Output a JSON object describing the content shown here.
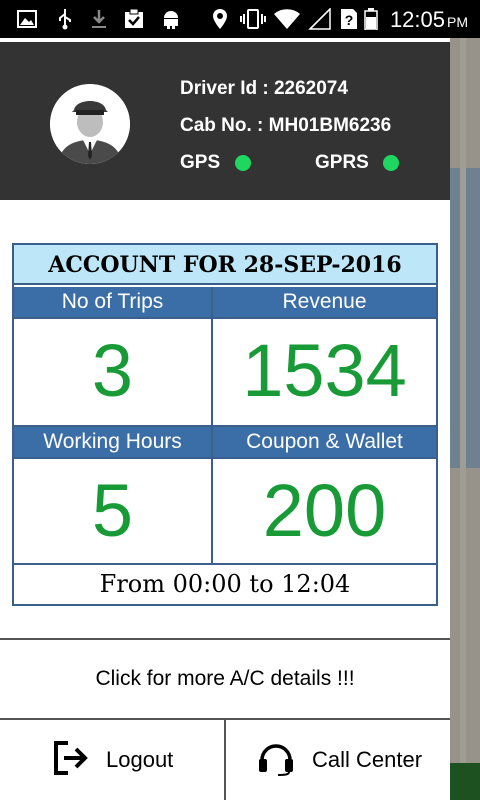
{
  "status_bar": {
    "icons": [
      "gallery-icon",
      "usb-icon",
      "download-icon",
      "clipboard-check-icon",
      "android-icon",
      "location-icon",
      "vibrate-icon",
      "wifi-icon",
      "signal-icon",
      "sim-unknown-icon",
      "battery-icon"
    ],
    "time": "12:05",
    "ampm": "PM"
  },
  "profile": {
    "driver_id": "Driver Id : 2262074",
    "cab_no": "Cab No.  : MH01BM6236",
    "gps_label": "GPS",
    "gprs_label": "GPRS",
    "gps_status_color": "#1ed760",
    "gprs_status_color": "#1ed760"
  },
  "account": {
    "title": "ACCOUNT FOR 28-SEP-2016",
    "trips_label": "No of Trips",
    "trips_value": "3",
    "revenue_label": "Revenue",
    "revenue_value": "1534",
    "hours_label": "Working Hours",
    "hours_value": "5",
    "coupon_label": "Coupon & Wallet",
    "coupon_value": "200",
    "range": "From 00:00 to 12:04"
  },
  "details_link": "Click for more A/C details !!!",
  "buttons": {
    "logout": "Logout",
    "call_center": "Call Center"
  },
  "colors": {
    "header_bg": "#333333",
    "table_header_bg": "#3b6ea6",
    "title_bg": "#bde6f8",
    "value_color": "#189a36"
  }
}
